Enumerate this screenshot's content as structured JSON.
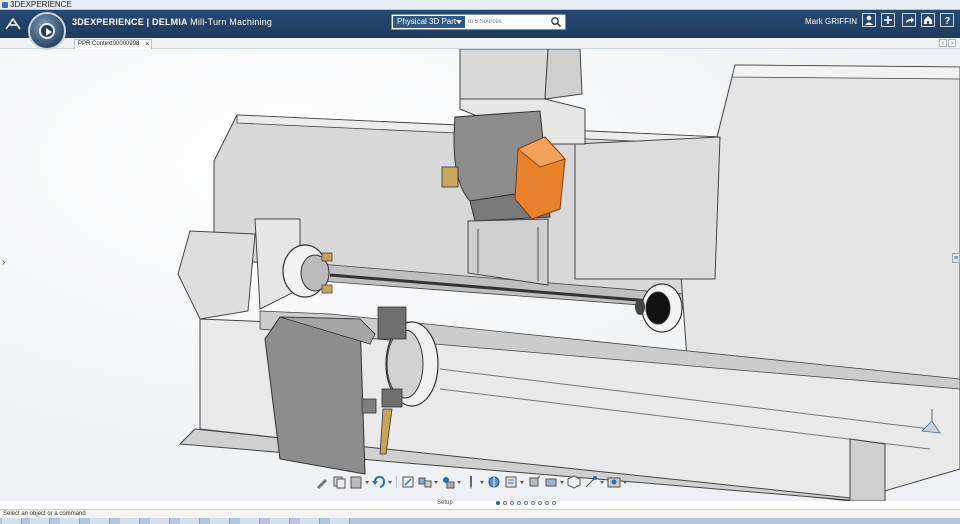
{
  "window": {
    "os_title": "3DEXPERIENCE"
  },
  "header": {
    "brand_prefix": "3DEXPERIENCE | ",
    "brand_name": "DELMIA",
    "app_name": "Mill-Turn Machining",
    "search": {
      "scope": "Physical 3D Part",
      "placeholder": "In 5 Sources"
    },
    "user_name": "Mark GRIFFIN",
    "icons": [
      "user-icon",
      "add-icon",
      "share-icon",
      "home-icon",
      "help-icon"
    ]
  },
  "tabs": [
    {
      "label": "PPR Context00000998",
      "active": true
    }
  ],
  "viewport": {
    "accent_color": "#e8822a",
    "machine_gray": "#d9d9d9"
  },
  "action_bar": {
    "section_label": "Setup",
    "pages": 9,
    "active_page": 0,
    "icons": [
      "brush-icon",
      "copy-icon",
      "paste-icon",
      "undo-icon",
      "fit-all-icon",
      "align-icon",
      "part-icon",
      "tool-icon",
      "operation-icon",
      "program-icon",
      "stock-icon",
      "fixture-icon",
      "view-icon",
      "compass-icon",
      "sim-icon"
    ]
  },
  "status_bar": {
    "message": "Select an object or a command"
  }
}
